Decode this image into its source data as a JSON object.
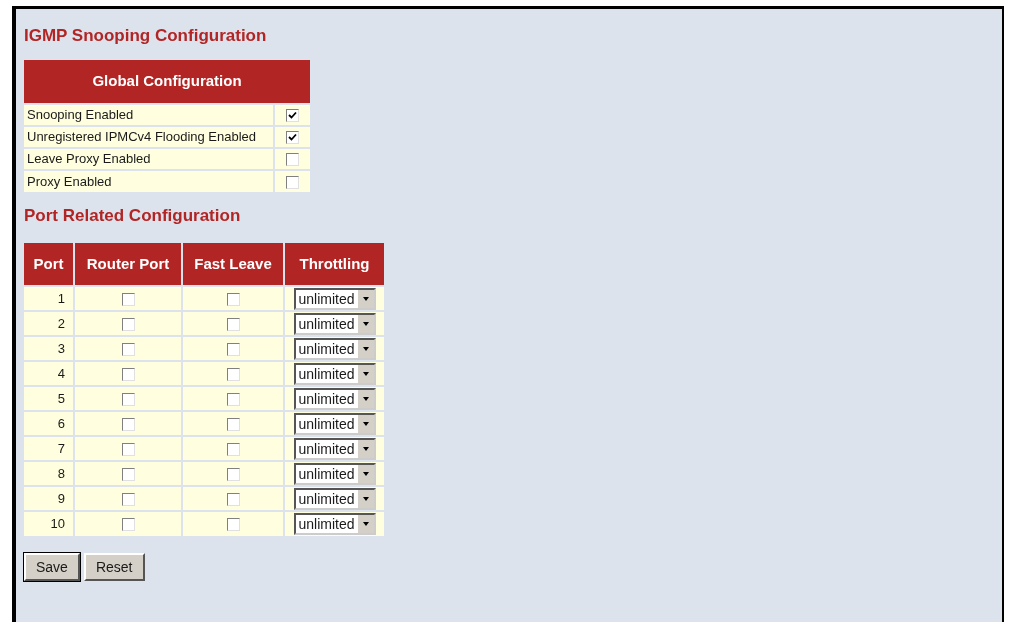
{
  "title": "IGMP Snooping Configuration",
  "global_config": {
    "heading": "Global Configuration",
    "items": [
      {
        "label": "Snooping Enabled",
        "checked": true
      },
      {
        "label": "Unregistered IPMCv4 Flooding Enabled",
        "checked": true
      },
      {
        "label": "Leave Proxy Enabled",
        "checked": false
      },
      {
        "label": "Proxy Enabled",
        "checked": false
      }
    ]
  },
  "port_config": {
    "heading": "Port Related Configuration",
    "columns": [
      "Port",
      "Router Port",
      "Fast Leave",
      "Throttling"
    ],
    "rows": [
      {
        "port": "1",
        "router_port": false,
        "fast_leave": false,
        "throttling": "unlimited"
      },
      {
        "port": "2",
        "router_port": false,
        "fast_leave": false,
        "throttling": "unlimited"
      },
      {
        "port": "3",
        "router_port": false,
        "fast_leave": false,
        "throttling": "unlimited"
      },
      {
        "port": "4",
        "router_port": false,
        "fast_leave": false,
        "throttling": "unlimited"
      },
      {
        "port": "5",
        "router_port": false,
        "fast_leave": false,
        "throttling": "unlimited"
      },
      {
        "port": "6",
        "router_port": false,
        "fast_leave": false,
        "throttling": "unlimited"
      },
      {
        "port": "7",
        "router_port": false,
        "fast_leave": false,
        "throttling": "unlimited"
      },
      {
        "port": "8",
        "router_port": false,
        "fast_leave": false,
        "throttling": "unlimited"
      },
      {
        "port": "9",
        "router_port": false,
        "fast_leave": false,
        "throttling": "unlimited"
      },
      {
        "port": "10",
        "router_port": false,
        "fast_leave": false,
        "throttling": "unlimited"
      }
    ]
  },
  "buttons": [
    "Save",
    "Reset"
  ]
}
